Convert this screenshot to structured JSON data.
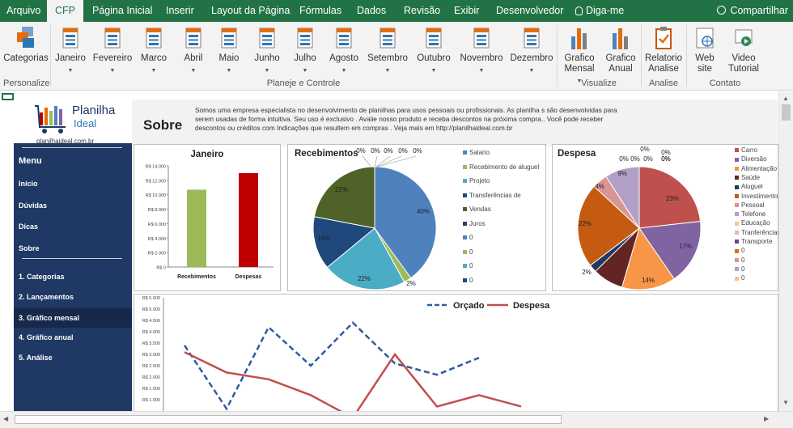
{
  "tabs": [
    "Arquivo",
    "CFP",
    "Página Inicial",
    "Inserir",
    "Layout da Página",
    "Fórmulas",
    "Dados",
    "Revisão",
    "Exibir",
    "Desenvolvedor",
    "Diga-me"
  ],
  "share_label": "Compartilhar",
  "ribbon": {
    "categorias": "Categorias",
    "months": [
      "Janeiro",
      "Fevereiro",
      "Marco",
      "Abril",
      "Maio",
      "Junho",
      "Julho",
      "Agosto",
      "Setembro",
      "Outubro",
      "Novembro",
      "Dezembro"
    ],
    "grafico_mensal": [
      "Grafico",
      "Mensal"
    ],
    "grafico_anual": [
      "Grafico",
      "Anual"
    ],
    "relatorio": [
      "Relatorio",
      "Analise"
    ],
    "web": [
      "Web",
      "site"
    ],
    "video": [
      "Video",
      "Tutorial"
    ],
    "groups": {
      "personalize": "Personalize",
      "planeje": "Planeje e Controle",
      "visualize": "Visualize",
      "analise": "Analise",
      "contato": "Contato"
    }
  },
  "logo": {
    "line1": "Planilha",
    "line2": "Ideal",
    "url": "planilhaideal.com.br"
  },
  "about": {
    "title": "Sobre",
    "text": "Somos uma empresa  especialista no desenvolvimento de planilhas  para usos  pessoais ou  profissionais. As planilha s são desenvolvidas  para serem usadas de forma intuitiva. Seu uso  é exclusivo .  Avalie nosso produto e receba  descontos na próxima compra.. Você pode receber descontos ou créditos com Indicações  que resultem em compras . Veja mais em http://planilhaideal.com.br"
  },
  "menu": {
    "title": "Menu",
    "links": [
      "Início",
      "Dúvidas",
      "Dicas",
      "Sobre"
    ],
    "items": [
      "1. Categorias",
      "2. Lançamentos",
      "3. Gráfico mensal",
      "4. Gráfico anual",
      "5. Análise"
    ]
  },
  "chart_data": [
    {
      "type": "bar",
      "title": "Janeiro",
      "categories": [
        "Recebimentos",
        "Despesas"
      ],
      "values": [
        10700,
        13000
      ],
      "colors": [
        "#9bbb59",
        "#c00000"
      ],
      "ylim": [
        0,
        14000
      ],
      "yticks": [
        "R$ 0",
        "R$ 2.000",
        "R$ 4.000",
        "R$ 6.000",
        "R$ 8.000",
        "R$ 10.000",
        "R$ 12.000",
        "R$ 14.000"
      ]
    },
    {
      "type": "pie",
      "title": "Recebimentos",
      "labels": [
        "Salario",
        "Recebimento de aluguel",
        "Projeto",
        "Transferências de",
        "Vendas",
        "Juros",
        "0",
        "0",
        "0",
        "0"
      ],
      "values": [
        40,
        2,
        22,
        14,
        22,
        0,
        0,
        0,
        0,
        0
      ],
      "value_labels": [
        "40%",
        "2%",
        "22%",
        "14%",
        "22%",
        "0%",
        "0%",
        "0%",
        "0%",
        "0%"
      ],
      "colors": [
        "#4f81bd",
        "#9bbb59",
        "#4bacc6",
        "#1f497d",
        "#4f6228",
        "#254061",
        "#4f81bd",
        "#9bbb59",
        "#4bacc6",
        "#1f497d"
      ]
    },
    {
      "type": "pie",
      "title": "Despesa",
      "labels": [
        "Carro",
        "Diversão",
        "Alimentação",
        "Saúde",
        "Aluguel",
        "Investimento",
        "Pessoal",
        "Telefone",
        "Educação",
        "Tranferências",
        "Transporte",
        "0",
        "0",
        "0",
        "0"
      ],
      "values": [
        23,
        17,
        14,
        8,
        2,
        22,
        4,
        9,
        0,
        0,
        0,
        0,
        0,
        0,
        0
      ],
      "value_labels": [
        "23%",
        "17%",
        "14%",
        "8%",
        "2%",
        "22%",
        "4%",
        "9%",
        "0%",
        "0%",
        "0%",
        "0%",
        "0%",
        "0%",
        "0%"
      ],
      "colors": [
        "#c0504d",
        "#8064a2",
        "#f79646",
        "#632523",
        "#1f3864",
        "#c55a11",
        "#d99594",
        "#b2a1c7",
        "#fac090",
        "#e6b9b8",
        "#604a7b",
        "#e46c0a",
        "#d99594",
        "#b2a1c7",
        "#fac090"
      ]
    },
    {
      "type": "line",
      "series": [
        {
          "name": "Orçado",
          "color": "#2e5c9e",
          "dash": true,
          "values": [
            3400,
            600,
            4200,
            2500,
            4400,
            2600,
            2100,
            2850
          ]
        },
        {
          "name": "Despesa",
          "color": "#c0504d",
          "dash": false,
          "values": [
            3100,
            2200,
            1900,
            1200,
            200,
            3000,
            700,
            1200,
            700
          ]
        }
      ],
      "ylim": [
        1000,
        5500
      ],
      "yticks": [
        "R$ 1.000",
        "R$ 1.500",
        "R$ 2.000",
        "R$ 2.500",
        "R$ 3.000",
        "R$ 3.500",
        "R$ 4.000",
        "R$ 4.500",
        "R$ 5.000",
        "R$ 5.500"
      ]
    }
  ]
}
